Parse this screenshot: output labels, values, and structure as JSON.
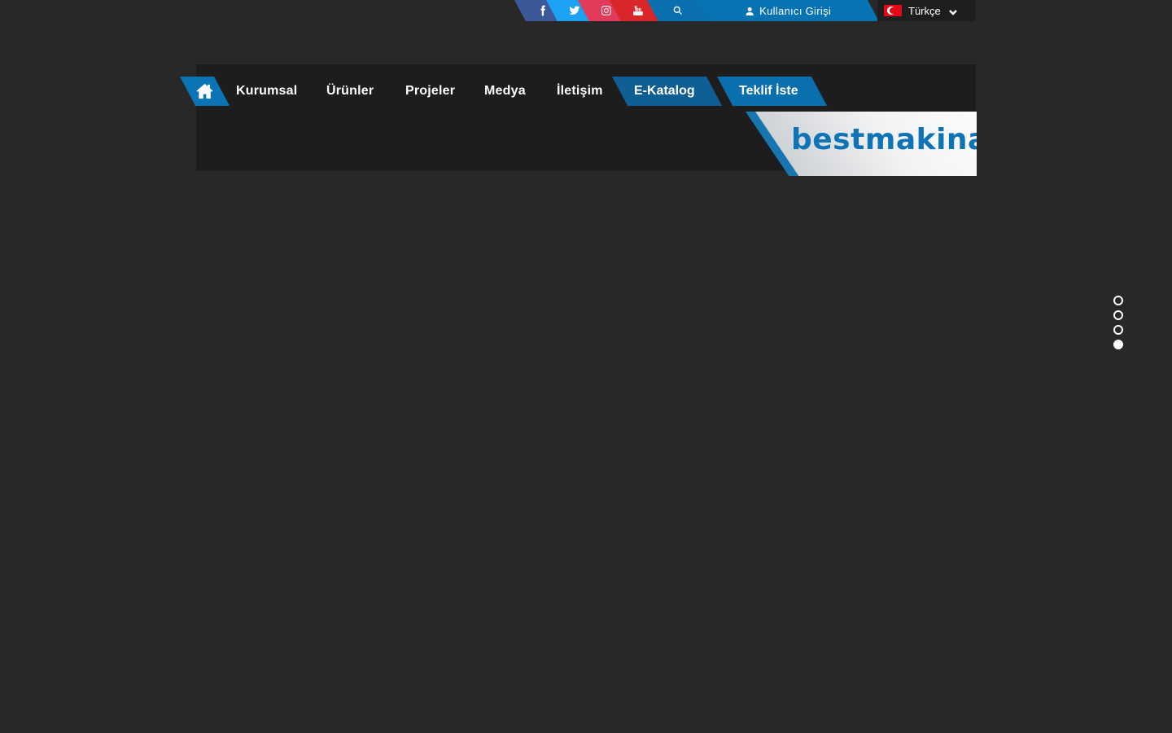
{
  "topbar": {
    "social": [
      {
        "name": "facebook",
        "icon": "facebook-icon",
        "color": "#3b5998"
      },
      {
        "name": "twitter",
        "icon": "twitter-icon",
        "color": "#1da1f2"
      },
      {
        "name": "instagram",
        "icon": "instagram-icon",
        "color": "#e23a5b"
      },
      {
        "name": "youtube",
        "icon": "youtube-icon",
        "color": "#d9262b"
      }
    ],
    "search_icon": "search-icon",
    "user_login_label": "Kullanıcı Girişi",
    "language": "Türkçe"
  },
  "nav": {
    "home_icon": "home-icon",
    "items": [
      "Kurumsal",
      "Ürünler",
      "Projeler",
      "Medya",
      "İletişim"
    ],
    "catalog_label": "E-Katalog",
    "quote_label": "Teklif İste"
  },
  "logo": {
    "text": "bestmakina",
    "color": "#0f74b6"
  },
  "slider": {
    "dot_count": 4,
    "active_index": 3
  },
  "colors": {
    "background": "#282828",
    "header": "#1d1d1d",
    "accent": "#0a74b5"
  }
}
